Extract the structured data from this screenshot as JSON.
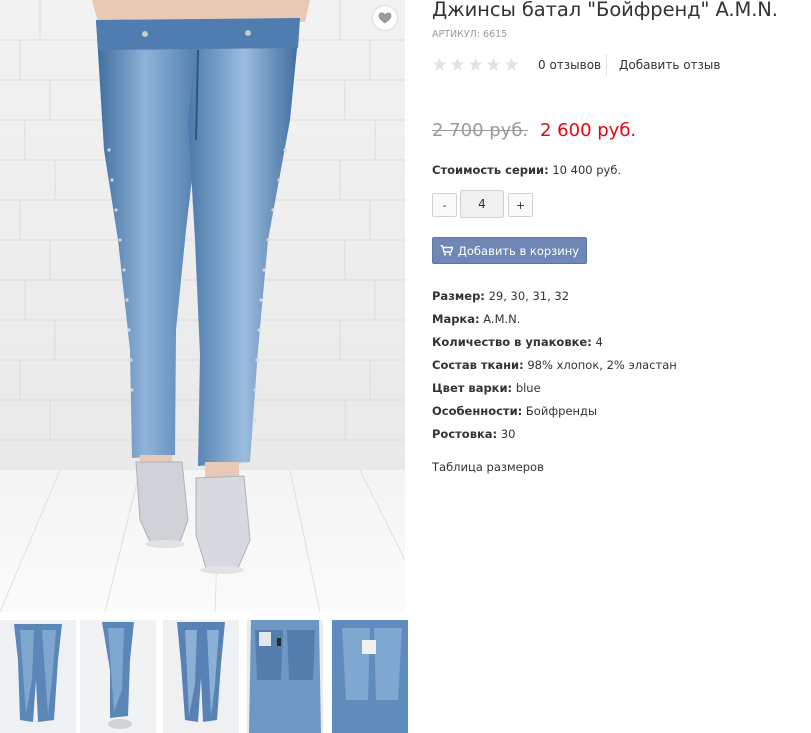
{
  "product": {
    "title": "Джинсы батал \"Бойфренд\" A.M.N.",
    "sku_label": "АРТИКУЛ:",
    "sku_value": "6615",
    "rating": {
      "stars_filled": 0,
      "stars_total": 5,
      "reviews_count": "0 отзывов",
      "add_review": "Добавить отзыв"
    },
    "price_old": "2 700 руб.",
    "price_new": "2 600 руб.",
    "series_label": "Стоимость серии:",
    "series_value": "10 400 руб.",
    "quantity": {
      "minus": "-",
      "value": "4",
      "plus": "+"
    },
    "add_to_cart": "Добавить в корзину",
    "properties": [
      {
        "label": "Размер:",
        "value": "29, 30, 31, 32"
      },
      {
        "label": "Марка:",
        "value": "A.M.N."
      },
      {
        "label": "Количество в упаковке:",
        "value": "4"
      },
      {
        "label": "Состав ткани:",
        "value": "98% хлопок, 2% эластан"
      },
      {
        "label": "Цвет варки:",
        "value": "blue"
      },
      {
        "label": "Особенности:",
        "value": "Бойфренды"
      },
      {
        "label": "Ростовка:",
        "value": "30"
      }
    ],
    "size_table": "Таблица размеров"
  },
  "gallery": {
    "thumbnail_count": 5
  },
  "colors": {
    "price_new": "#e30613",
    "price_old": "#9a9a9a",
    "cart_button": "#6f87b4",
    "star_empty": "#e3e3e3",
    "denim": "#5b86b8"
  },
  "icons": {
    "wishlist": "heart-icon",
    "cart": "cart-icon",
    "rating": "star-icon"
  }
}
